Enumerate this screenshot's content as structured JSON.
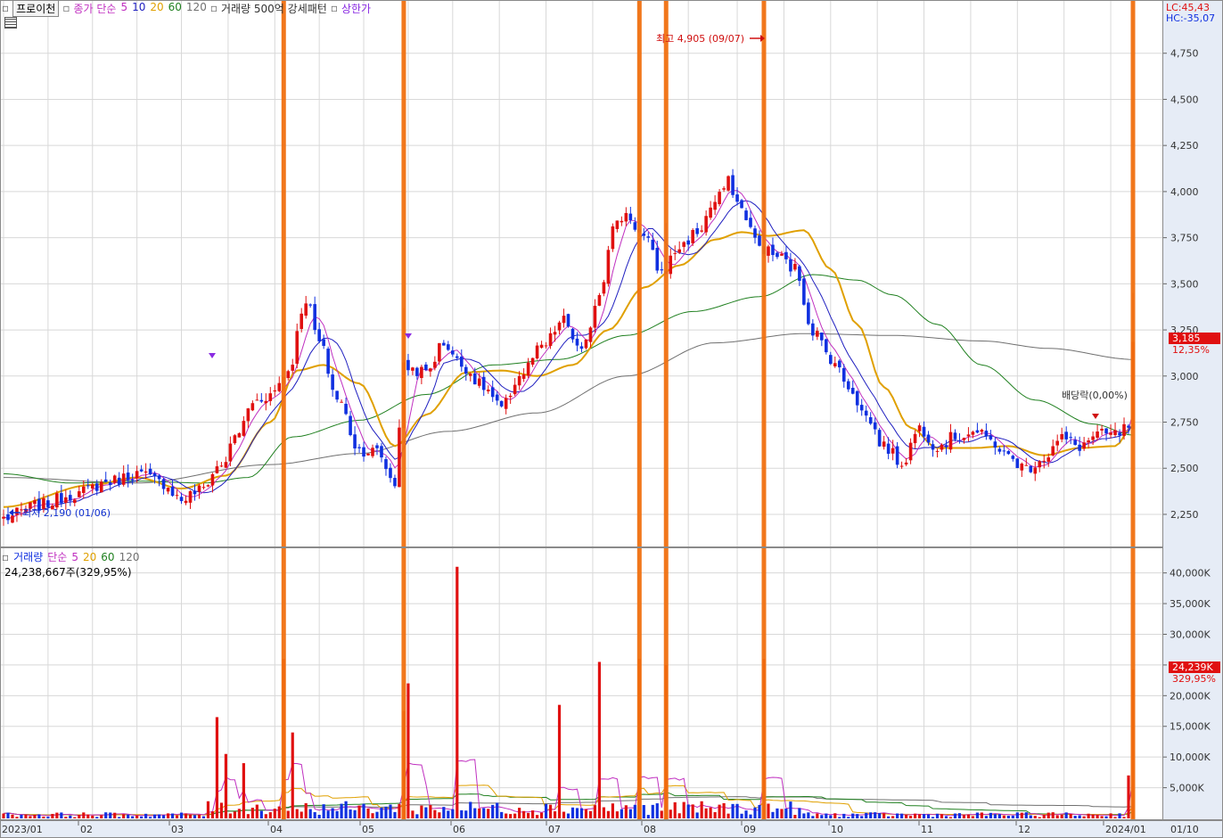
{
  "header": {
    "instrument": "프로이천",
    "price_legend": [
      {
        "text": "종가 단순",
        "color": "#c030c0"
      },
      {
        "text": "5",
        "color": "#c030c0"
      },
      {
        "text": "10",
        "color": "#2020c0"
      },
      {
        "text": "20",
        "color": "#e0a000"
      },
      {
        "text": "60",
        "color": "#208020"
      },
      {
        "text": "120",
        "color": "#707070"
      }
    ],
    "volume_filter": "거래량 500억 강세패턴",
    "limit_up": "상한가",
    "lc": "LC:45,43",
    "hc": "HC:-35,07"
  },
  "volume_header": {
    "title": "거래량",
    "ma_label": "단순",
    "ma_periods": [
      {
        "text": "5",
        "color": "#c030c0"
      },
      {
        "text": "20",
        "color": "#e0a000"
      },
      {
        "text": "60",
        "color": "#208020"
      },
      {
        "text": "120",
        "color": "#707070"
      }
    ],
    "current": "24,238,667주(329,95%)"
  },
  "annotations": {
    "high": "최고 4,905 (09/07)",
    "low": "최저 2,190 (01/06)",
    "dividend": "배당락(0,00%)",
    "last_price": "3,185",
    "last_change": "12,35%",
    "last_volume": "24,239K",
    "last_volume_change": "329,95%"
  },
  "colors": {
    "up": "#e01010",
    "down": "#1030e0",
    "signal": "#f07010",
    "ma5": "#c030c0",
    "ma10": "#2020c0",
    "ma20": "#e0a000",
    "ma60": "#208020",
    "ma120": "#707070",
    "axis_bg": "#e6ecf6"
  },
  "chart_data": {
    "type": "candlestick",
    "price_axis": {
      "ylim": [
        2100,
        5000
      ],
      "ticks": [
        "2,250",
        "2,500",
        "2,750",
        "3,000",
        "3,250",
        "3,500",
        "3,750",
        "4,000",
        "4,250",
        "4,500",
        "4,750"
      ]
    },
    "volume_axis": {
      "ylim": [
        0,
        43000
      ],
      "ticks": [
        "5,000K",
        "10,000K",
        "15,000K",
        "20,000K",
        "25,000K",
        "30,000K",
        "35,000K",
        "40,000K"
      ]
    },
    "x_labels": [
      "2023/01",
      "02",
      "03",
      "04",
      "05",
      "06",
      "07",
      "08",
      "09",
      "10",
      "11",
      "12",
      "2024/01",
      "01/10"
    ],
    "price_anchors": [
      [
        0,
        2230
      ],
      [
        8,
        2300
      ],
      [
        16,
        2360
      ],
      [
        24,
        2430
      ],
      [
        30,
        2470
      ],
      [
        36,
        2420
      ],
      [
        40,
        2330
      ],
      [
        44,
        2380
      ],
      [
        49,
        2520
      ],
      [
        53,
        2700
      ],
      [
        56,
        2860
      ],
      [
        60,
        2900
      ],
      [
        64,
        3030
      ],
      [
        68,
        3420
      ],
      [
        71,
        3180
      ],
      [
        75,
        2880
      ],
      [
        80,
        2600
      ],
      [
        84,
        2590
      ],
      [
        88,
        2420
      ],
      [
        90,
        3050
      ],
      [
        95,
        3020
      ],
      [
        99,
        3180
      ],
      [
        103,
        3060
      ],
      [
        108,
        2940
      ],
      [
        112,
        2820
      ],
      [
        116,
        3000
      ],
      [
        121,
        3150
      ],
      [
        126,
        3300
      ],
      [
        130,
        3120
      ],
      [
        134,
        3450
      ],
      [
        137,
        3800
      ],
      [
        140,
        3880
      ],
      [
        144,
        3750
      ],
      [
        148,
        3560
      ],
      [
        152,
        3700
      ],
      [
        156,
        3780
      ],
      [
        160,
        3940
      ],
      [
        163,
        4050
      ],
      [
        166,
        3900
      ],
      [
        170,
        3700
      ],
      [
        174,
        3650
      ],
      [
        178,
        3580
      ],
      [
        182,
        3250
      ],
      [
        186,
        3100
      ],
      [
        190,
        2950
      ],
      [
        194,
        2780
      ],
      [
        198,
        2620
      ],
      [
        202,
        2530
      ],
      [
        206,
        2720
      ],
      [
        210,
        2620
      ],
      [
        214,
        2670
      ],
      [
        218,
        2700
      ],
      [
        222,
        2650
      ],
      [
        226,
        2560
      ],
      [
        230,
        2500
      ],
      [
        234,
        2560
      ],
      [
        238,
        2660
      ],
      [
        242,
        2620
      ],
      [
        246,
        2680
      ],
      [
        250,
        2680
      ],
      [
        253,
        2720
      ],
      [
        254,
        3185
      ]
    ],
    "volume_spikes": [
      [
        48,
        16500
      ],
      [
        50,
        10500
      ],
      [
        54,
        9000
      ],
      [
        63,
        26000
      ],
      [
        65,
        14000
      ],
      [
        90,
        17500
      ],
      [
        91,
        22000
      ],
      [
        102,
        41000
      ],
      [
        125,
        18500
      ],
      [
        134,
        25500
      ],
      [
        143,
        26000
      ],
      [
        149,
        25000
      ],
      [
        171,
        26000
      ],
      [
        236,
        1000
      ],
      [
        253,
        7000
      ],
      [
        254,
        24239
      ]
    ],
    "signal_bars": [
      63,
      90,
      143,
      149,
      171,
      254
    ],
    "ma_curves": {
      "ma20": [
        [
          0,
          2290
        ],
        [
          20,
          2410
        ],
        [
          30,
          2450
        ],
        [
          40,
          2390
        ],
        [
          50,
          2460
        ],
        [
          60,
          2750
        ],
        [
          66,
          3030
        ],
        [
          72,
          3060
        ],
        [
          80,
          2960
        ],
        [
          88,
          2620
        ],
        [
          95,
          2790
        ],
        [
          104,
          3020
        ],
        [
          112,
          3030
        ],
        [
          120,
          3000
        ],
        [
          128,
          3060
        ],
        [
          136,
          3250
        ],
        [
          144,
          3480
        ],
        [
          152,
          3600
        ],
        [
          160,
          3740
        ],
        [
          166,
          3780
        ],
        [
          172,
          3760
        ],
        [
          180,
          3790
        ],
        [
          186,
          3580
        ],
        [
          192,
          3280
        ],
        [
          198,
          2940
        ],
        [
          204,
          2720
        ],
        [
          210,
          2610
        ],
        [
          218,
          2610
        ],
        [
          226,
          2620
        ],
        [
          234,
          2570
        ],
        [
          242,
          2610
        ],
        [
          250,
          2620
        ],
        [
          254,
          2730
        ]
      ],
      "ma60": [
        [
          0,
          2470
        ],
        [
          15,
          2420
        ],
        [
          30,
          2430
        ],
        [
          45,
          2420
        ],
        [
          55,
          2450
        ],
        [
          65,
          2670
        ],
        [
          80,
          2760
        ],
        [
          95,
          2900
        ],
        [
          110,
          3060
        ],
        [
          125,
          3090
        ],
        [
          140,
          3220
        ],
        [
          155,
          3350
        ],
        [
          170,
          3430
        ],
        [
          182,
          3550
        ],
        [
          192,
          3520
        ],
        [
          200,
          3440
        ],
        [
          210,
          3280
        ],
        [
          220,
          3060
        ],
        [
          232,
          2870
        ],
        [
          245,
          2740
        ],
        [
          254,
          2680
        ]
      ],
      "ma120": [
        [
          0,
          2450
        ],
        [
          30,
          2420
        ],
        [
          60,
          2520
        ],
        [
          80,
          2580
        ],
        [
          100,
          2700
        ],
        [
          120,
          2800
        ],
        [
          140,
          3000
        ],
        [
          160,
          3180
        ],
        [
          180,
          3230
        ],
        [
          200,
          3220
        ],
        [
          220,
          3190
        ],
        [
          235,
          3150
        ],
        [
          254,
          3090
        ]
      ]
    }
  }
}
